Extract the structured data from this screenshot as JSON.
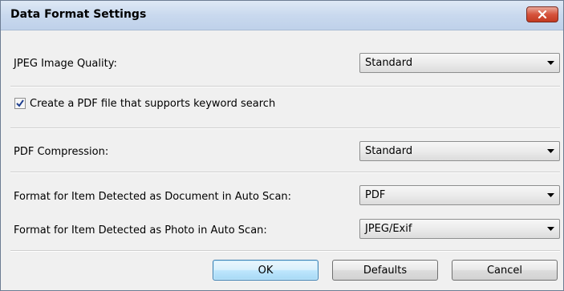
{
  "window": {
    "title": "Data Format Settings"
  },
  "jpeg_quality": {
    "label": "JPEG Image Quality:",
    "value": "Standard"
  },
  "keyword_search": {
    "label": "Create a PDF file that supports keyword search",
    "checked": true
  },
  "pdf_compression": {
    "label": "PDF Compression:",
    "value": "Standard"
  },
  "document_format": {
    "label": "Format for Item Detected as Document in Auto Scan:",
    "value": "PDF"
  },
  "photo_format": {
    "label": "Format for Item Detected as Photo in Auto Scan:",
    "value": "JPEG/Exif"
  },
  "buttons": {
    "ok": "OK",
    "defaults": "Defaults",
    "cancel": "Cancel"
  },
  "icons": {
    "close": "close-icon",
    "dropdown": "chevron-down-icon",
    "check": "checkmark-icon"
  }
}
